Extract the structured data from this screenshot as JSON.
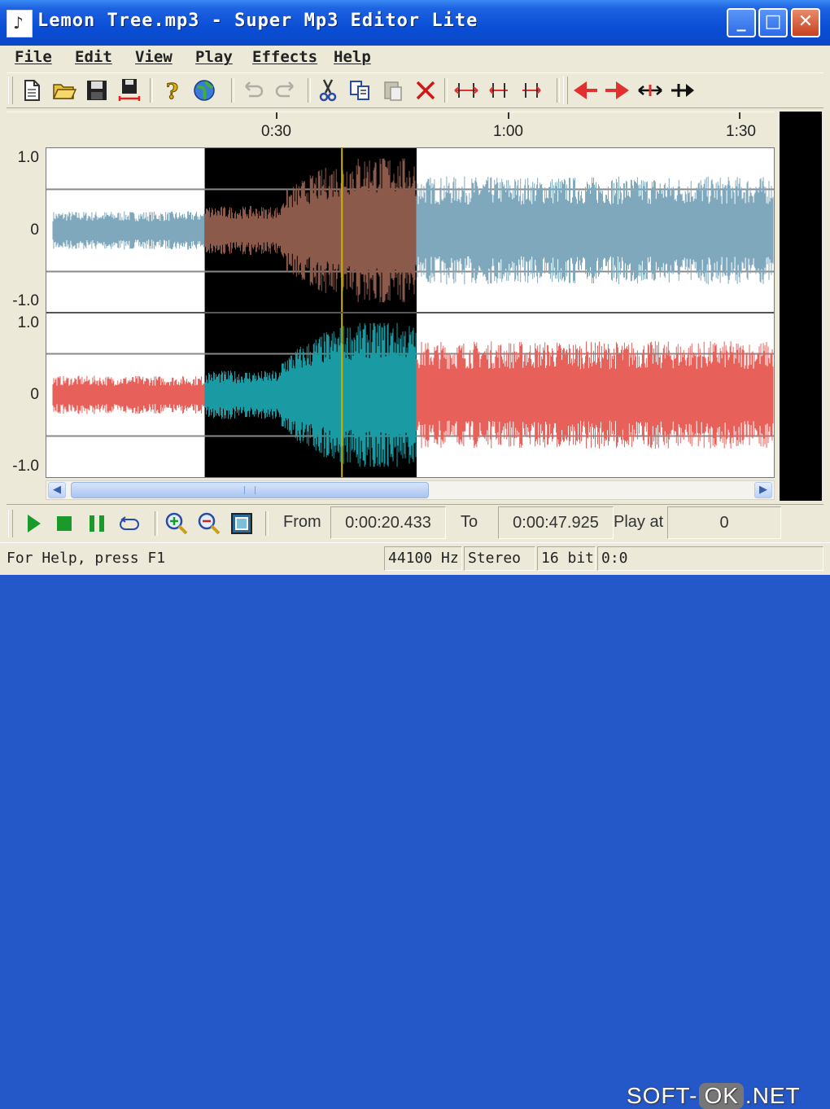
{
  "window": {
    "title": "Lemon Tree.mp3 - Super Mp3 Editor Lite",
    "controls": {
      "minimize": "_",
      "maximize": "□",
      "close": "✕"
    }
  },
  "menu": [
    "File",
    "Edit",
    "View",
    "Play",
    "Effects",
    "Help"
  ],
  "toolbar": {
    "buttons": [
      "new-file-icon",
      "open-folder-icon",
      "save-icon",
      "save-selection-icon",
      "help-icon",
      "web-globe-icon",
      "undo-icon",
      "redo-icon",
      "cut-icon",
      "copy-icon",
      "paste-icon",
      "delete-icon",
      "select-channel-icon",
      "select-left-icon",
      "select-right-icon",
      "move-left-icon",
      "move-right-icon",
      "trim-icon",
      "insert-icon"
    ]
  },
  "timeline": {
    "ticks": [
      "0:30",
      "1:00",
      "1:30"
    ]
  },
  "channels": [
    {
      "name": "left",
      "y_labels": [
        "1.0",
        "0",
        "-1.0"
      ],
      "color": "#7fa8bd",
      "selected_color": "#8c5a4b"
    },
    {
      "name": "right",
      "y_labels": [
        "1.0",
        "0",
        "-1.0"
      ],
      "color": "#e8605a",
      "selected_color": "#1a9ba3"
    }
  ],
  "selection": {
    "start_fraction": 0.218,
    "end_fraction": 0.509,
    "cursor_fraction": 0.406
  },
  "transport": {
    "buttons": [
      "play-icon",
      "stop-icon",
      "pause-icon",
      "loop-icon",
      "zoom-in-icon",
      "zoom-out-icon",
      "zoom-fit-icon"
    ],
    "from_label": "From",
    "from_value": "0:00:20.433",
    "to_label": "To",
    "to_value": "0:00:47.925",
    "play_at_label": "Play at",
    "play_at_value": "0"
  },
  "status": {
    "help_text": "For Help, press F1",
    "sample_rate": "44100 Hz",
    "channels": "Stereo",
    "bit_depth": "16 bit",
    "time": "0:0"
  },
  "watermark": {
    "prefix": "SOFT-",
    "ok": "OK",
    "suffix": ".NET"
  },
  "colors": {
    "title_bar": "#0a4ed6",
    "window_face": "#ece9d8",
    "cursor_line": "#c8b400"
  }
}
